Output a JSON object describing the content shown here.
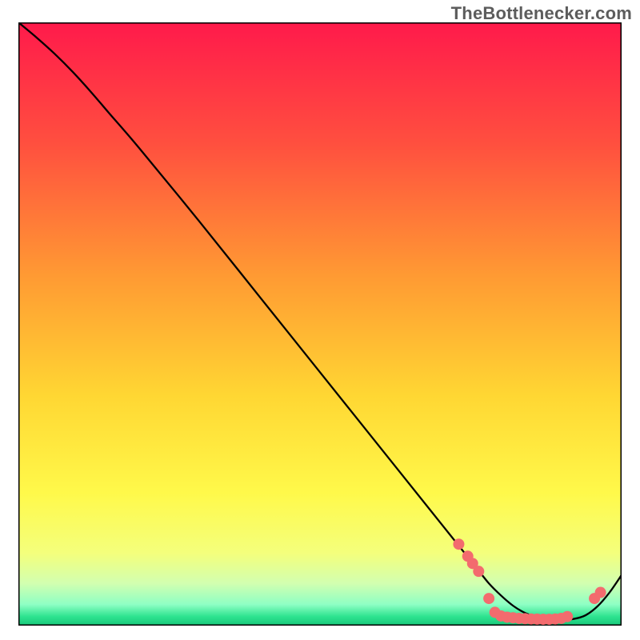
{
  "watermark": "TheBottlenecker.com",
  "chart_data": {
    "type": "line",
    "title": "",
    "xlabel": "",
    "ylabel": "",
    "xlim": [
      0,
      100
    ],
    "ylim": [
      0,
      100
    ],
    "gradient_stops": [
      {
        "offset": 0.0,
        "color": "#ff1a4b"
      },
      {
        "offset": 0.2,
        "color": "#ff4f3f"
      },
      {
        "offset": 0.42,
        "color": "#ff9a33"
      },
      {
        "offset": 0.62,
        "color": "#ffd733"
      },
      {
        "offset": 0.78,
        "color": "#fff94a"
      },
      {
        "offset": 0.88,
        "color": "#f4ff7c"
      },
      {
        "offset": 0.93,
        "color": "#d2ffb0"
      },
      {
        "offset": 0.965,
        "color": "#8effc4"
      },
      {
        "offset": 0.985,
        "color": "#2de38f"
      },
      {
        "offset": 1.0,
        "color": "#18c87a"
      }
    ],
    "series": [
      {
        "name": "bottleneck-curve",
        "stroke": "#000000",
        "x": [
          0,
          3,
          6,
          9,
          12,
          15,
          20,
          30,
          40,
          50,
          60,
          70,
          74,
          76,
          78,
          80,
          82,
          84,
          86,
          88,
          90,
          92,
          94,
          96,
          98,
          100
        ],
        "y": [
          100,
          97.5,
          94.8,
          91.8,
          88.5,
          85,
          79.2,
          67,
          54.5,
          42,
          29.5,
          17,
          12,
          9.5,
          7,
          5,
          3.3,
          2.1,
          1.4,
          1.1,
          1.0,
          1.1,
          1.7,
          3.2,
          5.5,
          8.4
        ]
      }
    ],
    "markers": {
      "color": "#f36b6e",
      "radius_px": 7,
      "points": [
        {
          "x": 73,
          "y": 13.5
        },
        {
          "x": 74.5,
          "y": 11.5
        },
        {
          "x": 75.3,
          "y": 10.3
        },
        {
          "x": 76.3,
          "y": 9.0
        },
        {
          "x": 78,
          "y": 4.5
        },
        {
          "x": 79,
          "y": 2.2
        },
        {
          "x": 80,
          "y": 1.6
        },
        {
          "x": 81,
          "y": 1.4
        },
        {
          "x": 82,
          "y": 1.3
        },
        {
          "x": 83,
          "y": 1.2
        },
        {
          "x": 84,
          "y": 1.15
        },
        {
          "x": 85,
          "y": 1.1
        },
        {
          "x": 86,
          "y": 1.07
        },
        {
          "x": 87,
          "y": 1.05
        },
        {
          "x": 88,
          "y": 1.05
        },
        {
          "x": 89,
          "y": 1.1
        },
        {
          "x": 90,
          "y": 1.2
        },
        {
          "x": 91,
          "y": 1.5
        },
        {
          "x": 95.5,
          "y": 4.5
        },
        {
          "x": 96.5,
          "y": 5.5
        }
      ]
    }
  }
}
